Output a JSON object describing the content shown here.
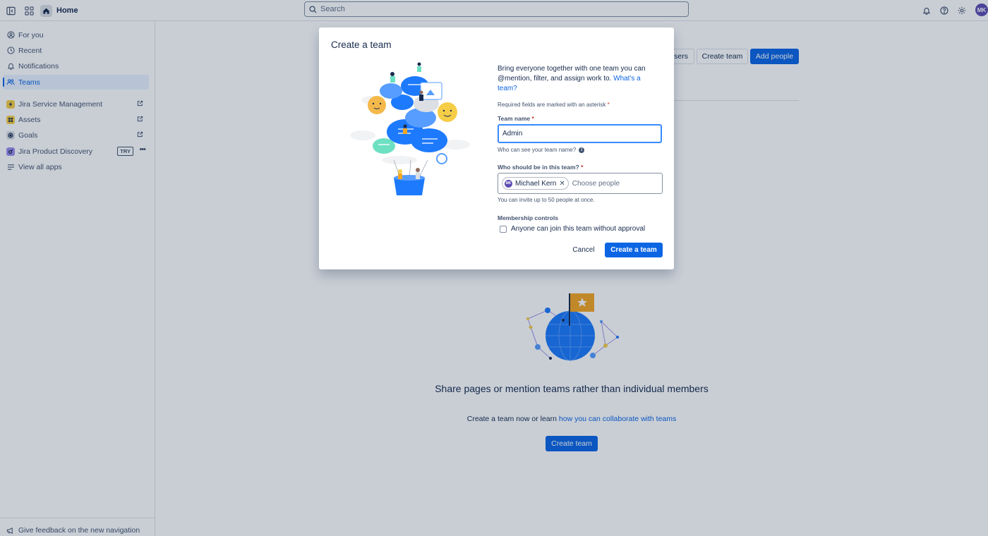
{
  "topbar": {
    "home_label": "Home",
    "search_placeholder": "Search",
    "avatar_initials": "MK"
  },
  "sidebar": {
    "items": [
      {
        "label": "For you",
        "icon": "user-circle-icon"
      },
      {
        "label": "Recent",
        "icon": "clock-icon"
      },
      {
        "label": "Notifications",
        "icon": "bell-icon"
      },
      {
        "label": "Teams",
        "icon": "people-icon"
      }
    ],
    "apps": [
      {
        "label": "Jira Service Management",
        "icon": "lightning-icon",
        "color": "#f5cd47"
      },
      {
        "label": "Assets",
        "icon": "assets-icon",
        "color": "#f5cd47"
      },
      {
        "label": "Goals",
        "icon": "goals-icon",
        "color": "#dcdfe4"
      },
      {
        "label": "Jira Product Discovery",
        "icon": "discovery-icon",
        "color": "#9f8fef",
        "badge": "TRY"
      }
    ],
    "view_all": "View all apps",
    "feedback": "Give feedback on the new navigation"
  },
  "main": {
    "buttons": {
      "users": "sers",
      "create_team": "Create team",
      "add_people": "Add people"
    },
    "empty": {
      "title": "Share pages or mention teams rather than individual members",
      "subtitle_prefix": "Create a team now or learn ",
      "subtitle_link": "how you can collaborate with teams",
      "button": "Create team"
    }
  },
  "modal": {
    "title": "Create a team",
    "intro": "Bring everyone together with one team you can @mention, filter, and assign work to.",
    "intro_link": "What's a team?",
    "required_note": "Required fields are marked with an asterisk",
    "team_name_label": "Team name",
    "team_name_value": "Admin",
    "team_name_helper": "Who can see your team name?",
    "members_label": "Who should be in this team?",
    "member_chip": "Michael Kern",
    "member_initials": "MK",
    "members_placeholder": "Choose people",
    "members_helper": "You can invite up to 50 people at once.",
    "membership_label": "Membership controls",
    "checkbox_label": "Anyone can join this team without approval",
    "cancel": "Cancel",
    "submit": "Create a team"
  },
  "colors": {
    "primary": "#0c66e4",
    "focus": "#388bff",
    "avatar": "#5e4db2"
  }
}
